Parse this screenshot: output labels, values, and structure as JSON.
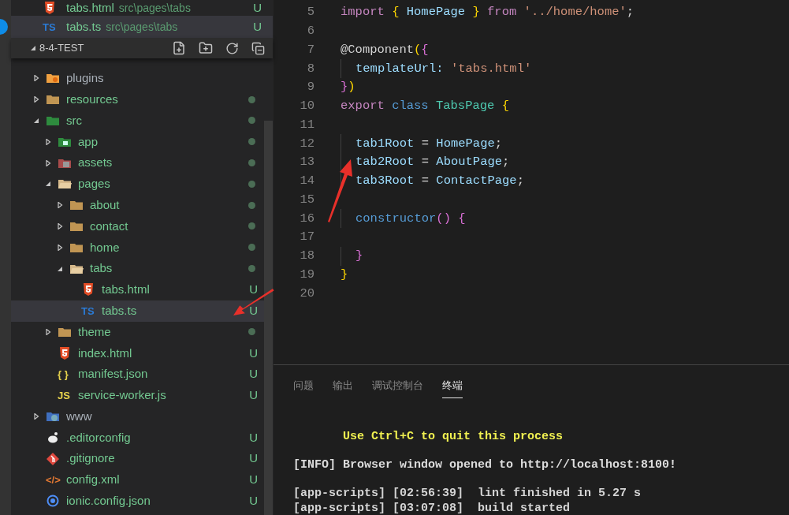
{
  "open_editors": [
    {
      "name": "tabs.html",
      "path": "src\\pages\\tabs",
      "kind": "html",
      "badge": "U",
      "selected": false
    },
    {
      "name": "tabs.ts",
      "path": "src\\pages\\tabs",
      "kind": "text",
      "icon_text": "TS",
      "badge": "U",
      "selected": true
    }
  ],
  "explorer": {
    "title": "8-4-TEST",
    "expanded": true,
    "tree": [
      {
        "name": "plugins",
        "kind": "plugin",
        "expanded": false,
        "dot": false,
        "selected": false
      },
      {
        "name": "resources",
        "kind": "folder",
        "expanded": false,
        "dot": true,
        "selected": false
      },
      {
        "name": "src",
        "kind": "src",
        "expanded": true,
        "dot": true,
        "selected": false,
        "children": [
          {
            "name": "app",
            "kind": "app",
            "expanded": false,
            "dot": true,
            "selected": false
          },
          {
            "name": "assets",
            "kind": "assets",
            "expanded": false,
            "dot": true,
            "selected": false
          },
          {
            "name": "pages",
            "kind": "folder-open",
            "expanded": true,
            "dot": true,
            "selected": false,
            "children": [
              {
                "name": "about",
                "kind": "folder",
                "expanded": false,
                "dot": true,
                "selected": false
              },
              {
                "name": "contact",
                "kind": "folder",
                "expanded": false,
                "dot": true,
                "selected": false
              },
              {
                "name": "home",
                "kind": "folder",
                "expanded": false,
                "dot": true,
                "selected": false
              },
              {
                "name": "tabs",
                "kind": "folder-open",
                "expanded": true,
                "dot": true,
                "selected": false,
                "children": [
                  {
                    "name": "tabs.html",
                    "kind": "html",
                    "badge": "U",
                    "dot": false,
                    "selected": false
                  },
                  {
                    "name": "tabs.ts",
                    "kind": "text",
                    "icon_text": "TS",
                    "badge": "U",
                    "dot": false,
                    "selected": true
                  }
                ]
              }
            ]
          },
          {
            "name": "theme",
            "kind": "folder",
            "expanded": false,
            "dot": true,
            "selected": false
          },
          {
            "name": "index.html",
            "kind": "html",
            "badge": "U",
            "dot": false,
            "selected": false
          },
          {
            "name": "manifest.json",
            "kind": "text",
            "icon_text": "{ }",
            "badge": "U",
            "dot": false,
            "selected": false
          },
          {
            "name": "service-worker.js",
            "kind": "text",
            "icon_text": "JS",
            "badge": "U",
            "dot": false,
            "selected": false
          }
        ]
      },
      {
        "name": "www",
        "kind": "www",
        "expanded": false,
        "dot": false,
        "selected": false
      },
      {
        "name": ".editorconfig",
        "kind": "editorconfig",
        "badge": "U",
        "dot": false,
        "selected": false
      },
      {
        "name": ".gitignore",
        "kind": "git",
        "badge": "U",
        "dot": false,
        "selected": false
      },
      {
        "name": "config.xml",
        "kind": "xml",
        "icon_text": "</>",
        "badge": "U",
        "dot": false,
        "selected": false
      },
      {
        "name": "ionic.config.json",
        "kind": "ionic",
        "badge": "U",
        "dot": false,
        "selected": false
      }
    ]
  },
  "editor": {
    "lines": [
      {
        "number": "5",
        "indented": false,
        "tokens": [
          {
            "t": "import ",
            "kind": "kw"
          },
          {
            "t": "{ ",
            "kind": "brace"
          },
          {
            "t": "HomePage ",
            "kind": "ident"
          },
          {
            "t": "} ",
            "kind": "brace"
          },
          {
            "t": "from ",
            "kind": "kw"
          },
          {
            "t": "'../home/home'",
            "kind": "str"
          },
          {
            "t": ";",
            "kind": "plain"
          }
        ]
      },
      {
        "number": "6",
        "indented": false
      },
      {
        "number": "7",
        "indented": false,
        "tokens": [
          {
            "t": "@Component",
            "kind": "plain"
          },
          {
            "t": "(",
            "kind": "brace"
          },
          {
            "t": "{",
            "kind": "brace2"
          }
        ]
      },
      {
        "number": "8",
        "indented": true,
        "tokens": [
          {
            "t": "templateUrl: ",
            "kind": "ident"
          },
          {
            "t": "'tabs.html'",
            "kind": "str"
          }
        ]
      },
      {
        "number": "9",
        "indented": false,
        "tokens": [
          {
            "t": "}",
            "kind": "brace2"
          },
          {
            "t": ")",
            "kind": "brace"
          }
        ]
      },
      {
        "number": "10",
        "indented": false,
        "tokens": [
          {
            "t": "export ",
            "kind": "kw"
          },
          {
            "t": "class ",
            "kind": "kw2"
          },
          {
            "t": "TabsPage ",
            "kind": "type"
          },
          {
            "t": "{",
            "kind": "brace"
          }
        ]
      },
      {
        "number": "11",
        "indented": false
      },
      {
        "number": "12",
        "indented": true,
        "tokens": [
          {
            "t": "tab1Root ",
            "kind": "ident"
          },
          {
            "t": "= ",
            "kind": "plain"
          },
          {
            "t": "HomePage",
            "kind": "ident"
          },
          {
            "t": ";",
            "kind": "plain"
          }
        ]
      },
      {
        "number": "13",
        "indented": true,
        "tokens": [
          {
            "t": "tab2Root ",
            "kind": "ident"
          },
          {
            "t": "= ",
            "kind": "plain"
          },
          {
            "t": "AboutPage",
            "kind": "ident"
          },
          {
            "t": ";",
            "kind": "plain"
          }
        ]
      },
      {
        "number": "14",
        "indented": true,
        "tokens": [
          {
            "t": "tab3Root ",
            "kind": "ident"
          },
          {
            "t": "= ",
            "kind": "plain"
          },
          {
            "t": "ContactPage",
            "kind": "ident"
          },
          {
            "t": ";",
            "kind": "plain"
          }
        ]
      },
      {
        "number": "15",
        "indented": false
      },
      {
        "number": "16",
        "indented": true,
        "tokens": [
          {
            "t": "constructor",
            "kind": "kw2"
          },
          {
            "t": "() ",
            "kind": "brace2"
          },
          {
            "t": "{",
            "kind": "brace2"
          }
        ]
      },
      {
        "number": "17",
        "indented": false
      },
      {
        "number": "18",
        "indented": true,
        "tokens": [
          {
            "t": "}",
            "kind": "brace2"
          }
        ]
      },
      {
        "number": "19",
        "indented": false,
        "tokens": [
          {
            "t": "}",
            "kind": "brace"
          }
        ]
      },
      {
        "number": "20",
        "indented": false
      }
    ]
  },
  "panel": {
    "tabs": [
      {
        "label": "问题",
        "selected": false
      },
      {
        "label": "输出",
        "selected": false
      },
      {
        "label": "调试控制台",
        "selected": false
      },
      {
        "label": "终端",
        "selected": true
      }
    ],
    "terminal": [
      {
        "text": "Use Ctrl+C to quit this process",
        "kind": "notice"
      },
      {
        "text": "[INFO] Browser window opened to http://localhost:8100!",
        "kind": "info"
      },
      {
        "text": "[app-scripts] [02:56:39]  lint finished in 5.27 s",
        "kind": "log"
      },
      {
        "text": "[app-scripts] [03:07:08]  build started",
        "kind": "progress"
      }
    ]
  }
}
